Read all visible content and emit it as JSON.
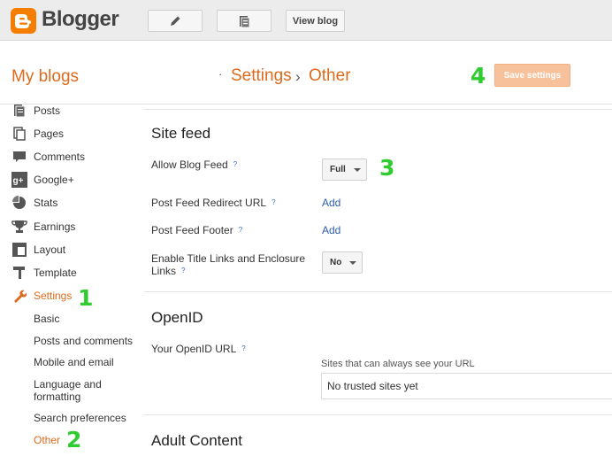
{
  "header": {
    "brand": "Blogger",
    "view_blog": "View blog"
  },
  "subheader": {
    "my_blogs": "My blogs",
    "bullet": "·",
    "crumb_settings": "Settings",
    "crumb_separator": "›",
    "crumb_other": "Other",
    "save_settings": "Save settings"
  },
  "annotations": {
    "n1": "1",
    "n2": "2",
    "n3": "3",
    "n4": "4"
  },
  "sidebar": {
    "items": [
      {
        "label": "Posts",
        "icon": "posts-icon"
      },
      {
        "label": "Pages",
        "icon": "pages-icon"
      },
      {
        "label": "Comments",
        "icon": "comments-icon"
      },
      {
        "label": "Google+",
        "icon": "google-plus-icon"
      },
      {
        "label": "Stats",
        "icon": "stats-icon"
      },
      {
        "label": "Earnings",
        "icon": "earnings-icon"
      },
      {
        "label": "Layout",
        "icon": "layout-icon"
      },
      {
        "label": "Template",
        "icon": "template-icon"
      },
      {
        "label": "Settings",
        "icon": "wrench-icon"
      }
    ],
    "sub": {
      "basic": "Basic",
      "posts_comments": "Posts and comments",
      "mobile_email": "Mobile and email",
      "language_formatting": "Language and\nformatting",
      "search_prefs": "Search preferences",
      "other": "Other"
    }
  },
  "site_feed": {
    "title": "Site feed",
    "allow_label": "Allow Blog Feed",
    "allow_value": "Full",
    "redirect_label": "Post Feed Redirect URL",
    "redirect_link": "Add",
    "footer_label": "Post Feed Footer",
    "footer_link": "Add",
    "enclosure_label_line1": "Enable Title Links and Enclosure",
    "enclosure_label_line2": "Links",
    "enclosure_value": "No",
    "help": "?"
  },
  "openid": {
    "title": "OpenID",
    "url_label": "Your OpenID URL",
    "hint": "Sites that can always see your URL",
    "trusted": "No trusted sites yet"
  },
  "adult": {
    "title": "Adult Content"
  },
  "colors": {
    "accent": "#dd6a1c",
    "annotation": "#2ecc2e",
    "link": "#2a5db0"
  }
}
